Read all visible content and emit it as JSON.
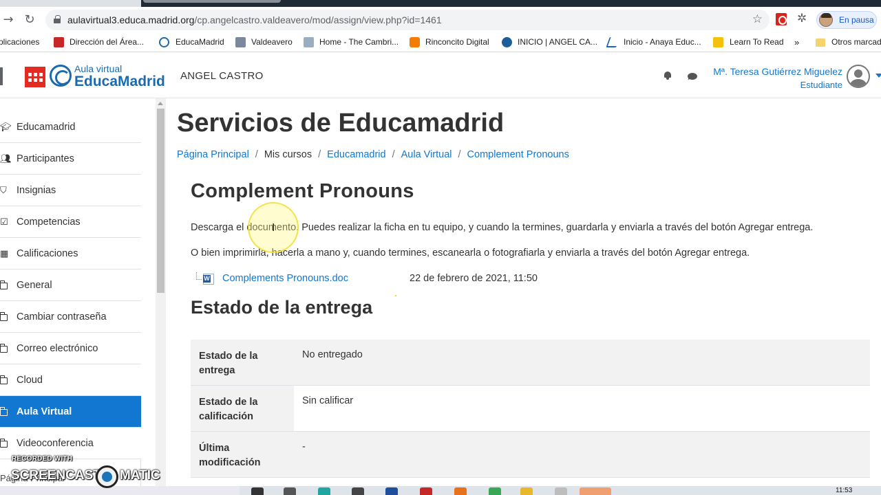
{
  "browser": {
    "url_host": "aulavirtual3.educa.madrid.org",
    "url_path": "/cp.angelcastro.valdeavero/mod/assign/view.php?id=1461",
    "profile_label": "En pausa",
    "bookmarks": [
      {
        "label": "plicaciones"
      },
      {
        "label": "Dirección del Área..."
      },
      {
        "label": "EducaMadrid"
      },
      {
        "label": "Valdeavero"
      },
      {
        "label": "Home - The Cambri..."
      },
      {
        "label": "Rinconcito Digital"
      },
      {
        "label": "INICIO | ANGEL CA..."
      },
      {
        "label": "Inicio - Anaya Educ..."
      },
      {
        "label": "Learn To Read"
      },
      {
        "label": "»"
      },
      {
        "label": "Otros marcad"
      }
    ]
  },
  "header": {
    "brand_sub": "Aula virtual",
    "brand_main": "EducaMadrid",
    "site_name": "ANGEL CASTRO",
    "user_name": "Mª. Teresa Gutiérrez Miguelez",
    "user_role": "Estudiante"
  },
  "nav": {
    "items": [
      {
        "label": "Educamadrid",
        "icon": "graduation-cap-icon"
      },
      {
        "label": "Participantes",
        "icon": "users-icon"
      },
      {
        "label": "Insignias",
        "icon": "shield-icon"
      },
      {
        "label": "Competencias",
        "icon": "check-square-icon"
      },
      {
        "label": "Calificaciones",
        "icon": "table-icon"
      },
      {
        "label": "General",
        "icon": "folder-icon"
      },
      {
        "label": "Cambiar contraseña",
        "icon": "folder-icon"
      },
      {
        "label": "Correo electrónico",
        "icon": "folder-icon"
      },
      {
        "label": "Cloud",
        "icon": "folder-icon"
      },
      {
        "label": "Aula Virtual",
        "icon": "folder-icon",
        "active": true
      },
      {
        "label": "Videoconferencia",
        "icon": "folder-icon"
      }
    ],
    "below_text": "Página Principal"
  },
  "main": {
    "page_heading": "Servicios de Educamadrid",
    "breadcrumb": [
      "Página Principal",
      "Mis cursos",
      "Educamadrid",
      "Aula Virtual",
      "Complement Pronouns"
    ],
    "assignment_title": "Complement Pronouns",
    "intro_1": "Descarga el documento. Puedes realizar la ficha en tu equipo, y cuando la termines, guardarla y enviarla a través del botón Agregar entrega.",
    "intro_2": "O bien imprimirla, hacerla a mano y, cuando termines, escanearla o fotografiarla y enviarla a través del botón Agregar entrega.",
    "file_name": "Complements Pronouns.doc",
    "file_date": "22 de febrero de 2021, 11:50",
    "status_heading": "Estado de la entrega",
    "status_rows": [
      {
        "label": "Estado de la entrega",
        "value": "No entregado"
      },
      {
        "label": "Estado de la calificación",
        "value": "Sin calificar"
      },
      {
        "label": "Última modificación",
        "value": "-"
      }
    ]
  },
  "watermark": {
    "small": "RECORDED WITH",
    "left": "SCREENCAST",
    "right": "MATIC"
  },
  "taskbar": {
    "clock": "11:53"
  },
  "colors": {
    "link": "#1177d1",
    "active_nav": "#1177d1",
    "brand": "#1b6aae",
    "cm_red": "#e32b23"
  }
}
